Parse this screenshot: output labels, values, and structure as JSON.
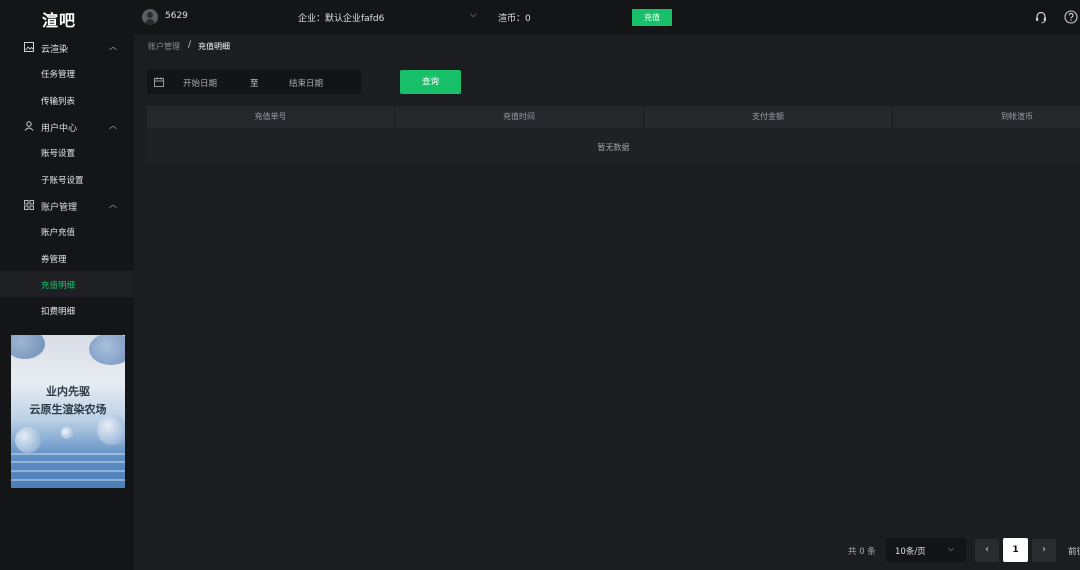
{
  "topbar": {
    "logo": "渲吧",
    "user_id": "5629",
    "company": "企业：默认企业fafd6",
    "coins": "渲币：0",
    "recharge_label": "充值"
  },
  "sidebar": {
    "groups": [
      {
        "label": "云渲染",
        "icon": "image-icon",
        "items": [
          {
            "label": "任务管理"
          },
          {
            "label": "传输列表"
          }
        ]
      },
      {
        "label": "用户中心",
        "icon": "user-icon",
        "items": [
          {
            "label": "账号设置"
          },
          {
            "label": "子账号设置"
          }
        ]
      },
      {
        "label": "账户管理",
        "icon": "grid-icon",
        "items": [
          {
            "label": "账户充值"
          },
          {
            "label": "券管理"
          },
          {
            "label": "充值明细",
            "active": true
          },
          {
            "label": "扣费明细"
          }
        ]
      }
    ],
    "promo": {
      "line1": "业内先驱",
      "line2": "云原生渲染农场"
    }
  },
  "breadcrumb": {
    "parent": "账户管理",
    "separator": "/",
    "current": "充值明细"
  },
  "filter": {
    "start_placeholder": "开始日期",
    "to": "至",
    "end_placeholder": "结束日期",
    "query_label": "查询"
  },
  "table": {
    "columns": [
      "充值单号",
      "充值时间",
      "支付金额",
      "到帐渲币"
    ],
    "empty_text": "暂无数据"
  },
  "pagination": {
    "total": "共 0 条",
    "page_size": "10条/页",
    "current_page": "1",
    "goto": "前往"
  },
  "colors": {
    "accent": "#19c06a",
    "background": "#1c1d20",
    "sidebar": "#141517"
  }
}
